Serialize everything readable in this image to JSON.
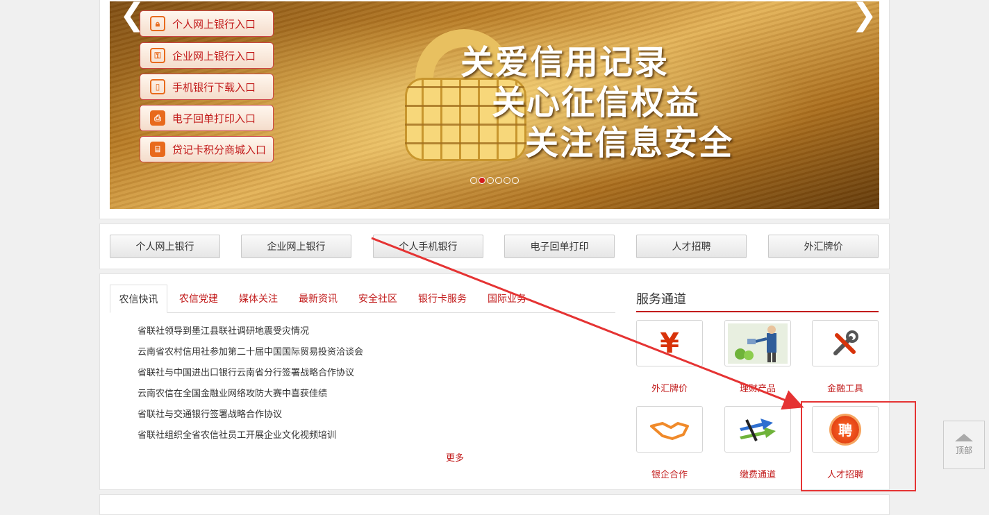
{
  "banner": {
    "slogan": [
      "关爱信用记录",
      "关心征信权益",
      "关注信息安全"
    ],
    "prev_arrow": "❮",
    "next_arrow": "❯",
    "slide_count": 6,
    "active_slide": 2,
    "quick_links": [
      {
        "label": "个人网上银行入口",
        "icon": "lock-icon"
      },
      {
        "label": "企业网上银行入口",
        "icon": "key-icon"
      },
      {
        "label": "手机银行下载入口",
        "icon": "mobile-phone-icon"
      },
      {
        "label": "电子回单打印入口",
        "icon": "printer-icon"
      },
      {
        "label": "贷记卡积分商城入口",
        "icon": "gift-icon"
      }
    ]
  },
  "nav_buttons": [
    "个人网上银行",
    "企业网上银行",
    "个人手机银行",
    "电子回单打印",
    "人才招聘",
    "外汇牌价"
  ],
  "news": {
    "tabs": [
      "农信快讯",
      "农信党建",
      "媒体关注",
      "最新资讯",
      "安全社区",
      "银行卡服务",
      "国际业务"
    ],
    "active_tab": "农信快讯",
    "items": [
      "省联社领导到墨江县联社调研地震受灾情况",
      "云南省农村信用社参加第二十届中国国际贸易投资洽谈会",
      "省联社与中国进出口银行云南省分行签署战略合作协议",
      "云南农信在全国金融业网络攻防大赛中喜获佳绩",
      "省联社与交通银行签署战略合作协议",
      "省联社组织全省农信社员工开展企业文化视频培训"
    ],
    "more": "更多"
  },
  "services": {
    "title": "服务通道",
    "items": [
      {
        "label": "外汇牌价",
        "icon": "currency-exchange-icon"
      },
      {
        "label": "理财产品",
        "icon": "watering-growth-icon"
      },
      {
        "label": "金融工具",
        "icon": "tools-icon"
      },
      {
        "label": "银企合作",
        "icon": "handshake-icon"
      },
      {
        "label": "缴费通道",
        "icon": "payment-arrows-icon"
      },
      {
        "label": "人才招聘",
        "icon": "recruit-badge-icon",
        "badge_text": "聘"
      }
    ]
  },
  "back_to_top": "顶部",
  "colors": {
    "accent": "#c21b1b",
    "annotation": "#e53333"
  }
}
